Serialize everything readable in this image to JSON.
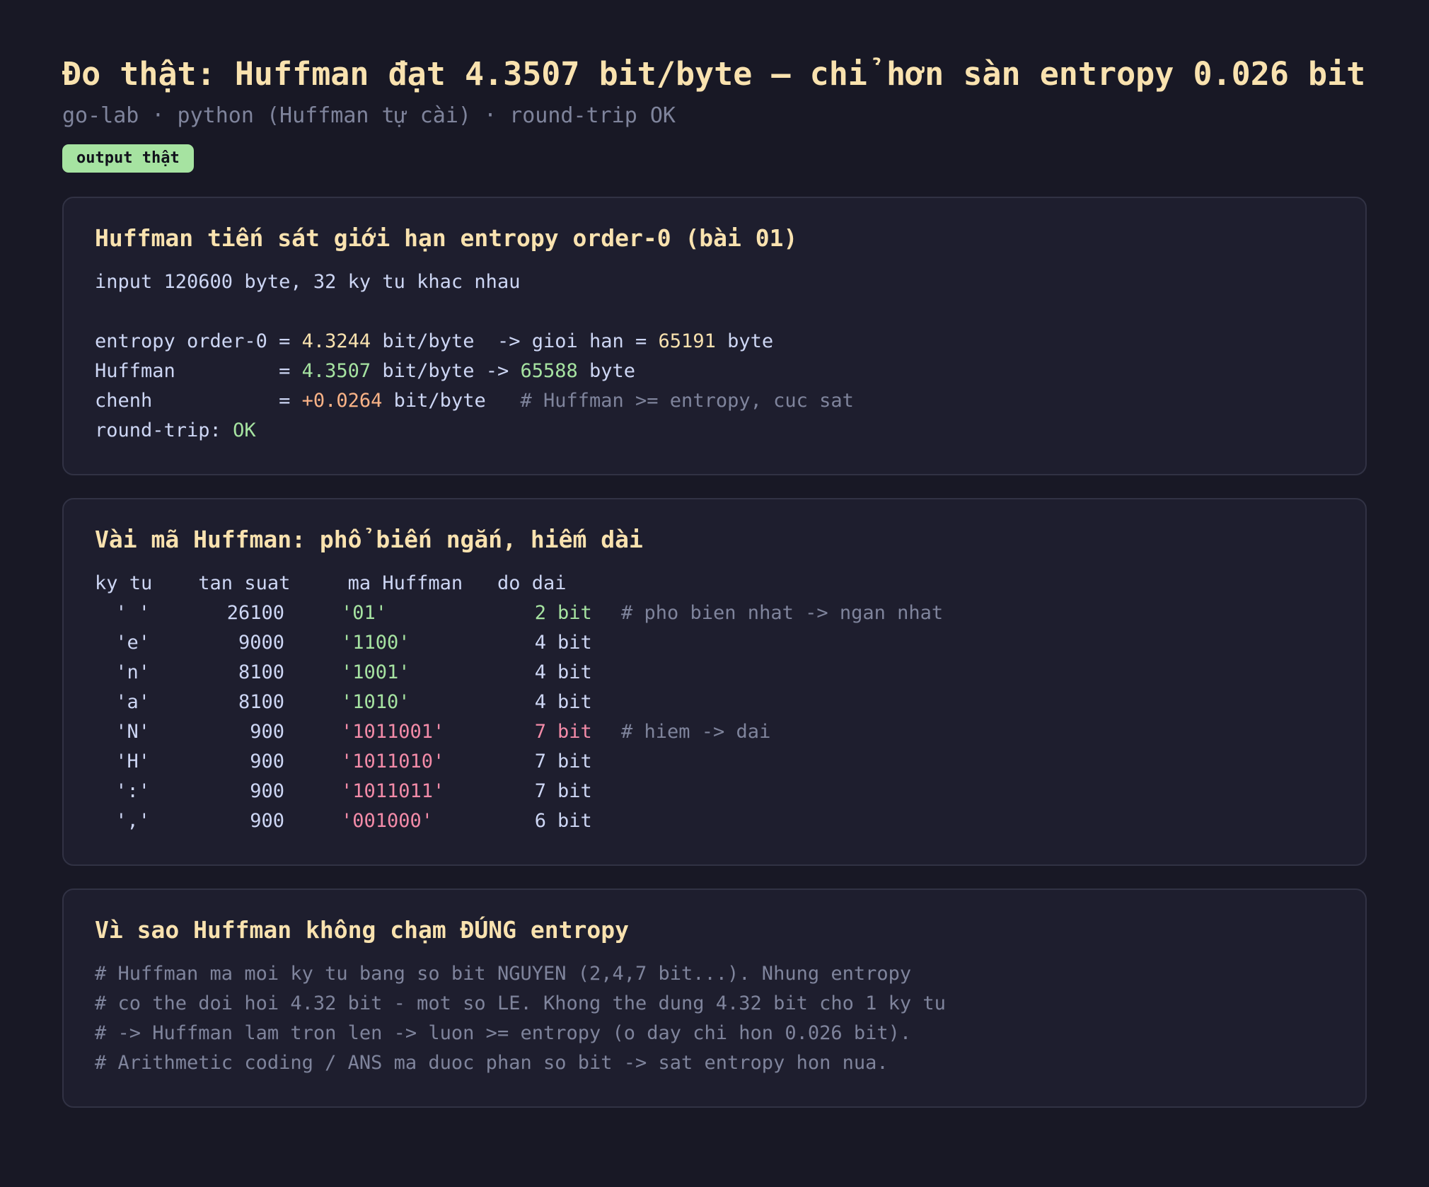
{
  "header": {
    "title": "Đo thật: Huffman đạt 4.3507 bit/byte — chỉ hơn sàn entropy 0.026 bit",
    "subtitle": "go-lab · python (Huffman tự cài) · round-trip OK",
    "badge": "output thật"
  },
  "card1": {
    "title": "Huffman tiến sát giới hạn entropy order-0 (bài 01)",
    "input_line": "input 120600 byte, 32 ky tu khac nhau",
    "entropy_label": "entropy order-0 = ",
    "entropy_value": "4.3244",
    "entropy_mid": " bit/byte  -> gioi han = ",
    "entropy_limit": "65191",
    "entropy_unit": " byte",
    "huffman_label": "Huffman         = ",
    "huffman_value": "4.3507",
    "huffman_mid": " bit/byte -> ",
    "huffman_bytes": "65588",
    "huffman_unit": " byte",
    "diff_label": "chenh           = ",
    "diff_value": "+0.0264",
    "diff_unit": " bit/byte   ",
    "diff_comment": "# Huffman >= entropy, cuc sat",
    "roundtrip_label": "round-trip: ",
    "roundtrip_value": "OK"
  },
  "card2": {
    "title": "Vài mã Huffman: phổ biến ngắn, hiếm dài",
    "header_line": "ky tu    tan suat     ma Huffman   do dai",
    "rows": [
      {
        "sym": "' '",
        "freq": "26100",
        "code": "'01'",
        "len": "2",
        "unit": "bit",
        "comment": "# pho bien nhat -> ngan nhat"
      },
      {
        "sym": "'e'",
        "freq": "9000",
        "code": "'1100'",
        "len": "4",
        "unit": "bit",
        "comment": ""
      },
      {
        "sym": "'n'",
        "freq": "8100",
        "code": "'1001'",
        "len": "4",
        "unit": "bit",
        "comment": ""
      },
      {
        "sym": "'a'",
        "freq": "8100",
        "code": "'1010'",
        "len": "4",
        "unit": "bit",
        "comment": ""
      },
      {
        "sym": "'N'",
        "freq": "900",
        "code": "'1011001'",
        "len": "7",
        "unit": "bit",
        "comment": "# hiem -> dai"
      },
      {
        "sym": "'H'",
        "freq": "900",
        "code": "'1011010'",
        "len": "7",
        "unit": "bit",
        "comment": ""
      },
      {
        "sym": "':'",
        "freq": "900",
        "code": "'1011011'",
        "len": "7",
        "unit": "bit",
        "comment": ""
      },
      {
        "sym": "','",
        "freq": "900",
        "code": "'001000'",
        "len": "6",
        "unit": "bit",
        "comment": ""
      }
    ]
  },
  "card3": {
    "title": "Vì sao Huffman không chạm ĐÚNG entropy",
    "lines": [
      "# Huffman ma moi ky tu bang so bit NGUYEN (2,4,7 bit...). Nhung entropy",
      "# co the doi hoi 4.32 bit - mot so LE. Khong the dung 4.32 bit cho 1 ky tu",
      "# -> Huffman lam tron len -> luon >= entropy (o day chi hon 0.026 bit).",
      "# Arithmetic coding / ANS ma duoc phan so bit -> sat entropy hon nua."
    ]
  }
}
